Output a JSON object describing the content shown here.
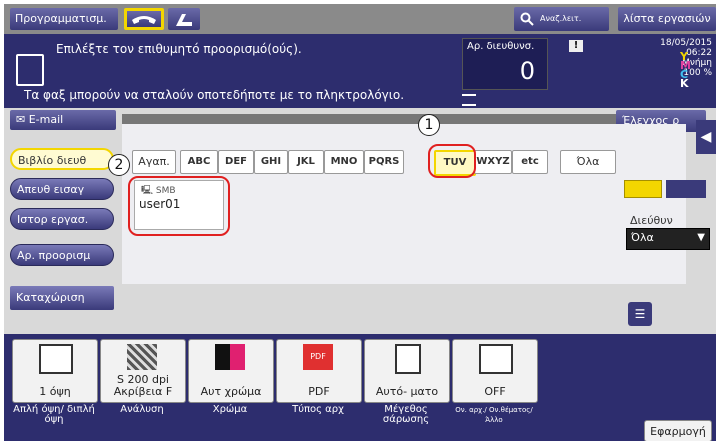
{
  "header": {
    "program_label": "Προγραμματισμ.",
    "phone_icon": "phone-icon",
    "fax_icon": "fax-icon",
    "search_label": "Αναζ.λειτ.",
    "jobs_label": "λίστα εργασιών"
  },
  "message": {
    "line1": "Επιλέξτε τον επιθυμητό προορισμό(ούς).",
    "line2": "Τα φαξ μπορούν να σταλούν οποτεδήποτε με το πληκτρολόγιο.",
    "address_count_label": "Αρ. διευθυνσ.",
    "address_count": "0",
    "date": "18/05/2015",
    "time": "06:22",
    "memory_label": "Μνήμη",
    "memory_value": "100 %",
    "toner_letters": [
      "Y",
      "M",
      "C",
      "K"
    ],
    "email_label": "E-mail",
    "check_label": "Έλεγχος ρ"
  },
  "nav": {
    "address_book": "Βιβλίο διευθ",
    "direct_input": "Απευθ εισαγ",
    "job_history": "Ιστορ εργασ.",
    "dest_number": "Αρ. προορισμ",
    "register": "Καταχώριση"
  },
  "filters": [
    "Αγαπ.",
    "ABC",
    "DEF",
    "GHI",
    "JKL",
    "MNO",
    "PQRS",
    "TUV",
    "WXYZ",
    "etc",
    "Όλα"
  ],
  "selected_filter": "TUV",
  "destination": {
    "type": "SMB",
    "name": "user01"
  },
  "annotations": [
    "1",
    "2"
  ],
  "address_type": {
    "label": "Διεύθυν",
    "value": "Όλα"
  },
  "settings": [
    {
      "value": "1 όψη",
      "caption": "Απλή όψη/ διπλή όψη"
    },
    {
      "value": "S 200 dpi Ακρίβεια F",
      "caption": "Ανάλυση"
    },
    {
      "value": "Αυτ χρώμα",
      "caption": "Χρώμα"
    },
    {
      "value": "PDF",
      "caption": "Τύπος αρχ"
    },
    {
      "value": "Αυτό- ματο",
      "caption": "Μέγεθος σάρωσης"
    },
    {
      "value": "OFF",
      "caption": "Ον. αρχ./ Ον.θέματος/ Άλλο"
    }
  ],
  "apply_label": "Εφαρμογή",
  "colors": {
    "accent_yellow": "#f3d600",
    "panel_navy": "#2d2d6e",
    "button_purple": "#3a3a7a",
    "annotation_red": "#e02020"
  }
}
